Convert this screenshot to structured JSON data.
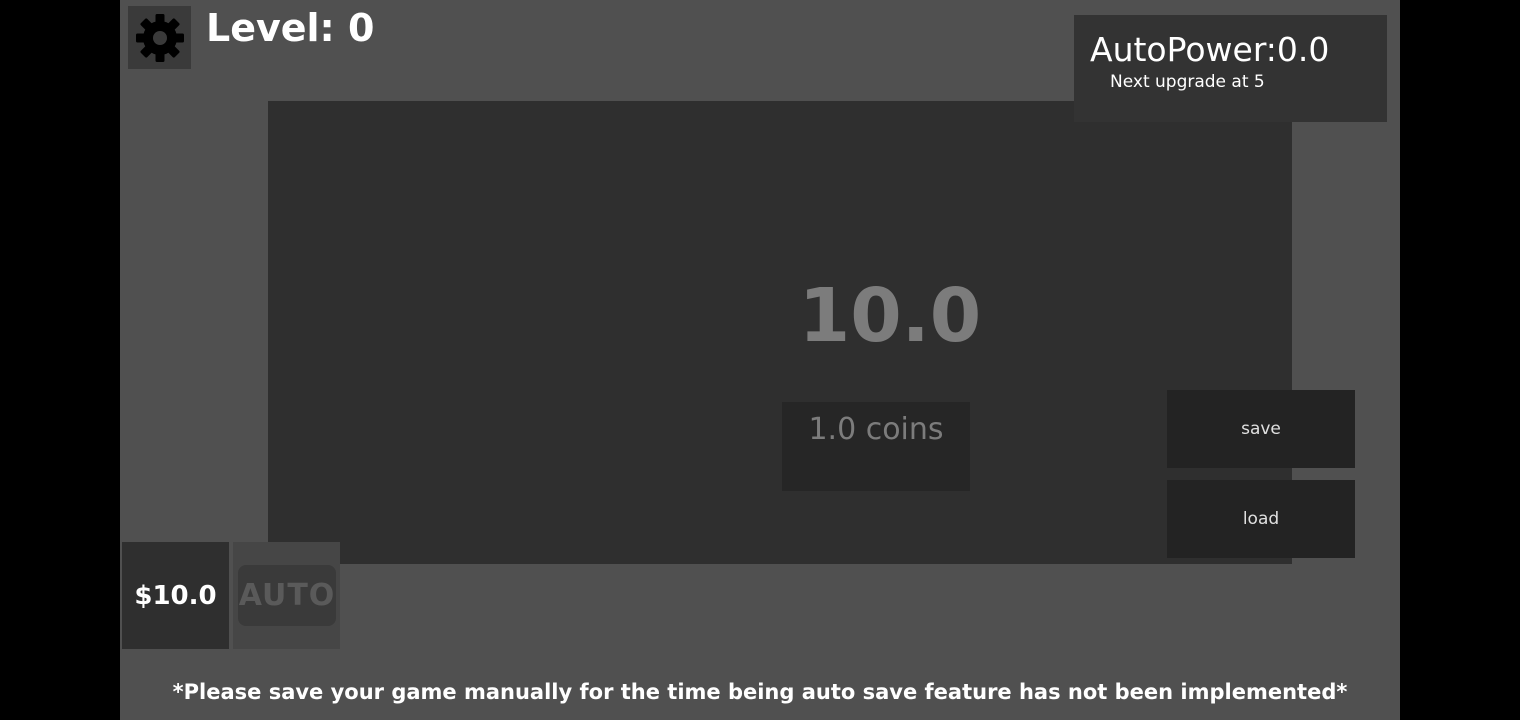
{
  "header": {
    "level_label": "Level: 0",
    "settings_icon": "gear-icon"
  },
  "auto_panel": {
    "auto_power": "AutoPower:0.0",
    "next_upgrade": "Next upgrade at 5"
  },
  "main": {
    "coin_count": "10.0",
    "click_button_label": "1.0 coins",
    "save_label": "save",
    "load_label": "load"
  },
  "bottom": {
    "money_label": "$10.0",
    "auto_label": "AUTO"
  },
  "notice": "*Please save your game manually for the time being auto save feature has not been implemented*",
  "colors": {
    "background": "#505050",
    "panel": "#2f2f2f",
    "button": "#232323",
    "text": "#ffffff",
    "muted_text": "#7c7c7c"
  }
}
